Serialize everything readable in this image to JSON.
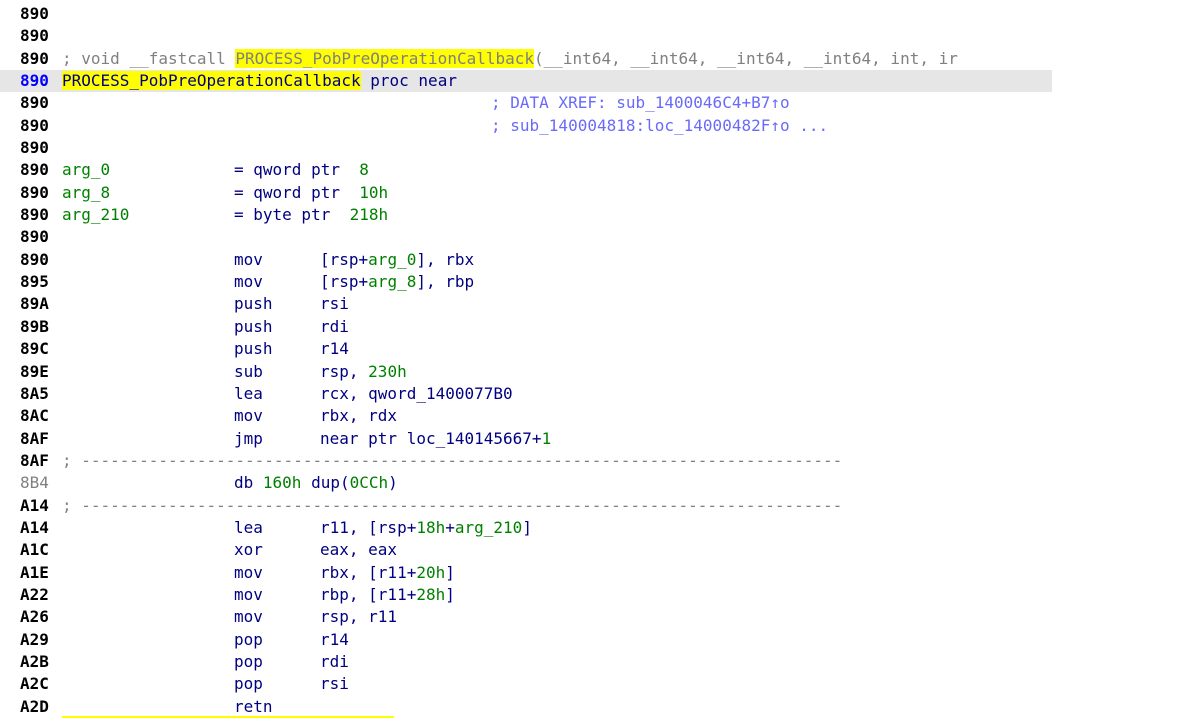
{
  "header": {
    "prototype_prefix": "; void __fastcall ",
    "function_name": "PROCESS_PobPreOperationCallback",
    "prototype_args": "(__int64, __int64, __int64, __int64, int, ir",
    "proc_suffix": " proc near",
    "xref_1": "; DATA XREF: sub_1400046C4+B7↑o",
    "xref_2": "; sub_140004818:loc_14000482F↑o ..."
  },
  "args": [
    {
      "addr": "890",
      "name": "arg_0",
      "type": "= qword ptr  ",
      "offset": "8"
    },
    {
      "addr": "890",
      "name": "arg_8",
      "type": "= qword ptr  ",
      "offset": "10h"
    },
    {
      "addr": "890",
      "name": "arg_210",
      "type": "= byte ptr  ",
      "offset": "218h"
    }
  ],
  "addresses": {
    "blank": "890",
    "sep1": "8AF",
    "db": "8B4",
    "sep2": "A14"
  },
  "separator_text": "; -------------------------------------------------------------------------------",
  "db_line": {
    "mnemonic": "db ",
    "count": "160h",
    "mid": " dup(",
    "value": "0CCh",
    "end": ")"
  },
  "instructions_block1": [
    {
      "addr": "890",
      "mnemonic": "mov",
      "op_a": "[rsp+",
      "op_b": "arg_0",
      "op_c": "], rbx"
    },
    {
      "addr": "895",
      "mnemonic": "mov",
      "op_a": "[rsp+",
      "op_b": "arg_8",
      "op_c": "], rbp"
    },
    {
      "addr": "89A",
      "mnemonic": "push",
      "op_a": "rsi",
      "op_b": "",
      "op_c": ""
    },
    {
      "addr": "89B",
      "mnemonic": "push",
      "op_a": "rdi",
      "op_b": "",
      "op_c": ""
    },
    {
      "addr": "89C",
      "mnemonic": "push",
      "op_a": "r14",
      "op_b": "",
      "op_c": ""
    },
    {
      "addr": "89E",
      "mnemonic": "sub",
      "op_a": "rsp, ",
      "op_b": "230h",
      "op_c": ""
    },
    {
      "addr": "8A5",
      "mnemonic": "lea",
      "op_a": "rcx, qword_1400077B0",
      "op_b": "",
      "op_c": ""
    },
    {
      "addr": "8AC",
      "mnemonic": "mov",
      "op_a": "rbx, rdx",
      "op_b": "",
      "op_c": ""
    },
    {
      "addr": "8AF",
      "mnemonic": "jmp",
      "op_a": "near ptr loc_140145667+",
      "op_b": "1",
      "op_c": ""
    }
  ],
  "instructions_block2": [
    {
      "addr": "A14",
      "mnemonic": "lea",
      "op_a": "r11, [rsp+",
      "op_b": "18h",
      "op_c": "+",
      "op_d": "arg_210",
      "op_e": "]"
    },
    {
      "addr": "A1C",
      "mnemonic": "xor",
      "op_a": "eax, eax",
      "op_b": "",
      "op_c": "",
      "op_d": "",
      "op_e": ""
    },
    {
      "addr": "A1E",
      "mnemonic": "mov",
      "op_a": "rbx, [r11+",
      "op_b": "20h",
      "op_c": "]",
      "op_d": "",
      "op_e": ""
    },
    {
      "addr": "A22",
      "mnemonic": "mov",
      "op_a": "rbp, [r11+",
      "op_b": "28h",
      "op_c": "]",
      "op_d": "",
      "op_e": ""
    },
    {
      "addr": "A26",
      "mnemonic": "mov",
      "op_a": "rsp, r11",
      "op_b": "",
      "op_c": "",
      "op_d": "",
      "op_e": ""
    },
    {
      "addr": "A29",
      "mnemonic": "pop",
      "op_a": "r14",
      "op_b": "",
      "op_c": "",
      "op_d": "",
      "op_e": ""
    },
    {
      "addr": "A2B",
      "mnemonic": "pop",
      "op_a": "rdi",
      "op_b": "",
      "op_c": "",
      "op_d": "",
      "op_e": ""
    },
    {
      "addr": "A2C",
      "mnemonic": "pop",
      "op_a": "rsi",
      "op_b": "",
      "op_c": "",
      "op_d": "",
      "op_e": ""
    },
    {
      "addr": "A2D",
      "mnemonic": "retn",
      "op_a": "",
      "op_b": "",
      "op_c": "",
      "op_d": "",
      "op_e": ""
    }
  ],
  "colors": {
    "address": "#000000",
    "current_address": "#0000ff",
    "highlight": "#ffff00",
    "number": "#008000",
    "code": "#000080",
    "comment": "#808080",
    "xref": "#6a6afa"
  }
}
